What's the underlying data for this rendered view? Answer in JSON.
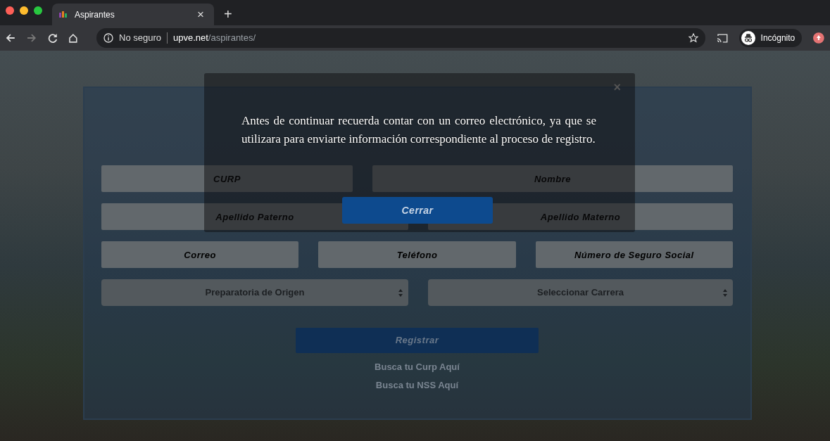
{
  "browser": {
    "tab": {
      "title": "Aspirantes",
      "close": "×",
      "selected": true
    },
    "new_tab": "+",
    "security": "No seguro",
    "url_host": "upve.net",
    "url_path": "/aspirantes/",
    "profile": "Incógnito"
  },
  "form": {
    "rows": [
      {
        "fields": [
          {
            "placeholder": "CURP"
          },
          {
            "placeholder": "Nombre"
          }
        ]
      },
      {
        "fields": [
          {
            "placeholder": "Apellido Paterno"
          },
          {
            "placeholder": "Apellido Materno"
          }
        ]
      },
      {
        "fields": [
          {
            "placeholder": "Correo"
          },
          {
            "placeholder": "Teléfono"
          },
          {
            "placeholder": "Número de Seguro Social"
          }
        ]
      }
    ],
    "selects": [
      {
        "value": "Preparatoria de Origen"
      },
      {
        "value": "Seleccionar Carrera"
      }
    ],
    "submit": "Registrar",
    "links": [
      "Busca tu Curp Aquí",
      "Busca tu NSS Aquí"
    ]
  },
  "modal": {
    "close": "×",
    "message": "Antes de continuar recuerda contar con un correo electrónico, ya que se utilizara para enviarte información correspondiente al proceso de registro.",
    "button": "Cerrar"
  }
}
